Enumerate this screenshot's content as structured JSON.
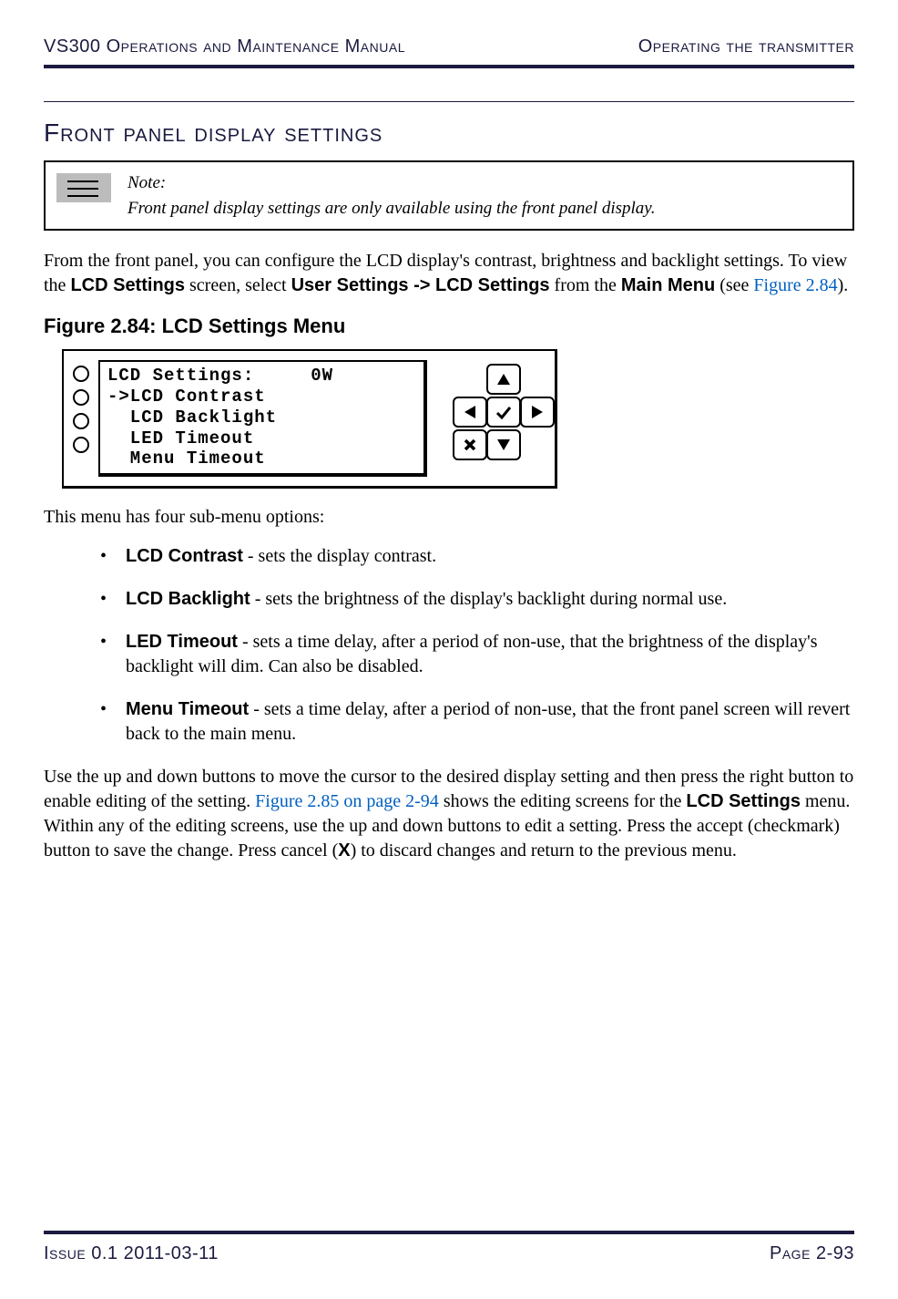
{
  "header": {
    "left": "VS300 Operations and Maintenance Manual",
    "right": "Operating the transmitter"
  },
  "section_title": "Front panel display settings",
  "note": {
    "label": "Note:",
    "body": "Front panel display settings are only available using the front panel display."
  },
  "intro": {
    "p1a": "From the front panel, you can configure the LCD display's contrast, brightness and backlight settings. To view the ",
    "p1b": "LCD Settings",
    "p1c": " screen, select ",
    "p1d": "User Settings -> LCD Settings",
    "p1e": " from the ",
    "p1f": "Main Menu",
    "p1g": " (see ",
    "p1h": "Figure 2.84",
    "p1i": ")."
  },
  "figure_caption": "Figure 2.84: LCD Settings Menu",
  "lcd": {
    "line1": "LCD Settings:     0W",
    "line2": "->LCD Contrast",
    "line3": "  LCD Backlight",
    "line4": "  LED Timeout",
    "line5": "  Menu Timeout"
  },
  "submenu_intro": "This menu has four sub-menu options:",
  "options": [
    {
      "name": "LCD Contrast",
      "desc": " - sets the display contrast."
    },
    {
      "name": "LCD Backlight",
      "desc": " - sets the brightness of the display's backlight during normal use."
    },
    {
      "name": "LED Timeout",
      "desc": " - sets a time delay, after a period of non-use, that the brightness of the display's backlight will dim. Can also be disabled."
    },
    {
      "name": "Menu Timeout",
      "desc": " - sets a time delay, after a period of non-use, that the front panel screen will revert back to the main menu."
    }
  ],
  "closing": {
    "a": "Use the up and down buttons to move the cursor to the desired display setting and then press the right button to enable editing of the setting. ",
    "b": "Figure 2.85 on page 2-94",
    "c": " shows the editing screens for the ",
    "d": "LCD Settings",
    "e": " menu. Within any of the editing screens, use the up and down buttons to edit a setting. Press the accept (checkmark) button to save the change. Press cancel (",
    "f": "X",
    "g": ") to discard changes and return to the previous menu."
  },
  "footer": {
    "left": "Issue 0.1  2011-03-11",
    "right": "Page 2-93"
  }
}
